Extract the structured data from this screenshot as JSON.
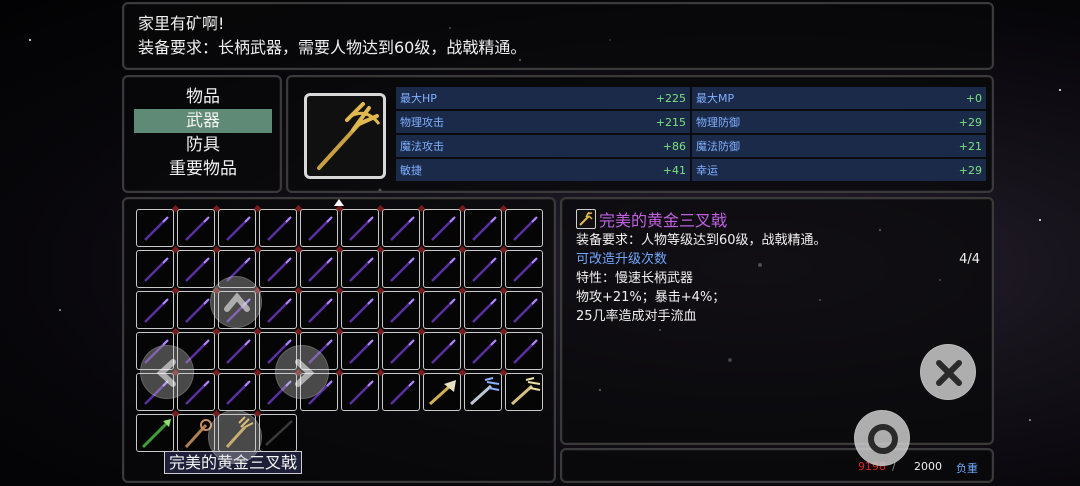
{
  "message": {
    "line1": "家里有矿啊!",
    "line2": "装备要求：长柄武器，需要人物达到60级，战戟精通。"
  },
  "categories": [
    {
      "label": "物品",
      "active": false
    },
    {
      "label": "武器",
      "active": true
    },
    {
      "label": "防具",
      "active": false
    },
    {
      "label": "重要物品",
      "active": false
    }
  ],
  "item_icon": "golden-trident-icon",
  "stats": [
    [
      {
        "name": "最大HP",
        "value": "+225"
      },
      {
        "name": "最大MP",
        "value": "+0"
      }
    ],
    [
      {
        "name": "物理攻击",
        "value": "+215"
      },
      {
        "name": "物理防御",
        "value": "+29"
      }
    ],
    [
      {
        "name": "魔法攻击",
        "value": "+86"
      },
      {
        "name": "魔法防御",
        "value": "+21"
      }
    ],
    [
      {
        "name": "敏捷",
        "value": "+41"
      },
      {
        "name": "幸运",
        "value": "+29"
      }
    ]
  ],
  "inventory": {
    "selected_name": "完美的黄金三叉戟",
    "rows": [
      [
        "purple-spear-icon",
        "purple-spear-icon",
        "purple-spear-icon",
        "purple-spear-icon",
        "purple-spear-icon",
        "purple-spear-icon",
        "purple-spear-icon",
        "purple-spear-icon",
        "purple-spear-icon",
        "purple-spear-icon"
      ],
      [
        "purple-spear-icon",
        "purple-spear-icon",
        "purple-spear-icon",
        "purple-spear-icon",
        "purple-spear-icon",
        "purple-spear-icon",
        "purple-spear-icon",
        "purple-spear-icon",
        "purple-spear-icon",
        "purple-spear-icon"
      ],
      [
        "purple-spear-icon",
        "purple-spear-icon",
        "purple-spear-icon",
        "purple-spear-icon",
        "purple-spear-icon",
        "purple-spear-icon",
        "purple-spear-icon",
        "purple-spear-icon",
        "purple-spear-icon",
        "purple-spear-icon"
      ],
      [
        "purple-spear-icon",
        "purple-spear-icon",
        "purple-spear-icon",
        "purple-spear-icon",
        "purple-spear-icon",
        "purple-spear-icon",
        "purple-spear-icon",
        "purple-spear-icon",
        "purple-spear-icon",
        "purple-spear-icon"
      ],
      [
        "purple-spear-icon",
        "purple-spear-icon",
        "purple-spear-icon",
        "purple-spear-icon",
        "purple-spear-icon",
        "purple-spear-icon",
        "purple-spear-icon",
        "golden-axe-icon",
        "silver-claw-icon",
        "golden-claw-icon"
      ],
      [
        "green-spear-icon",
        "golden-staff-icon",
        "golden-trident-icon",
        "dark-spear-icon"
      ]
    ]
  },
  "detail": {
    "title": "完美的黄金三叉戟",
    "requirement": "装备要求：人物等级达到60级，战戟精通。",
    "upgrade_label": "可改造升级次数",
    "upgrade_count": "4/4",
    "trait": "特性：慢速长柄武器",
    "bonus": "物攻+21%；暴击+4%；",
    "bleed": "25几率造成对手流血"
  },
  "weight": {
    "current": "9198",
    "separator": "/",
    "max": "2000",
    "label": "负重"
  },
  "colors": {
    "accent_active": "#5f8a76",
    "stat_bg": "#1c2a4a",
    "stat_name": "#7fb0ff",
    "stat_value": "#7de07d",
    "item_name": "#c060e0",
    "over_weight": "#dd2222"
  }
}
